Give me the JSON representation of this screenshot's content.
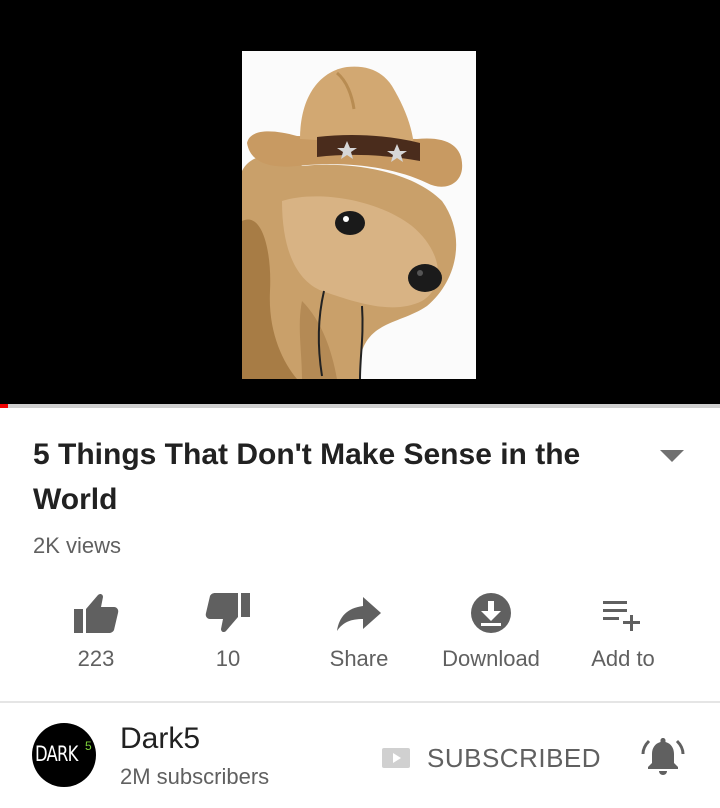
{
  "video": {
    "title": "5 Things That Don't Make Sense in the World",
    "views": "2K views",
    "progress_fraction": 0.01,
    "thumbnail_alt": "dog in cowboy hat"
  },
  "actions": [
    {
      "icon": "thumbs-up-icon",
      "label": "223"
    },
    {
      "icon": "thumbs-down-icon",
      "label": "10"
    },
    {
      "icon": "share-icon",
      "label": "Share"
    },
    {
      "icon": "download-icon",
      "label": "Download"
    },
    {
      "icon": "add-to-playlist-icon",
      "label": "Add to"
    }
  ],
  "channel": {
    "avatar_text": "DARK",
    "avatar_num": "5",
    "name": "Dark5",
    "subscribers": "2M subscribers",
    "subscribed_label": "SUBSCRIBED"
  },
  "colors": {
    "player_bg": "#000000",
    "progress": "#ee0000",
    "icon_gray": "#606060"
  }
}
